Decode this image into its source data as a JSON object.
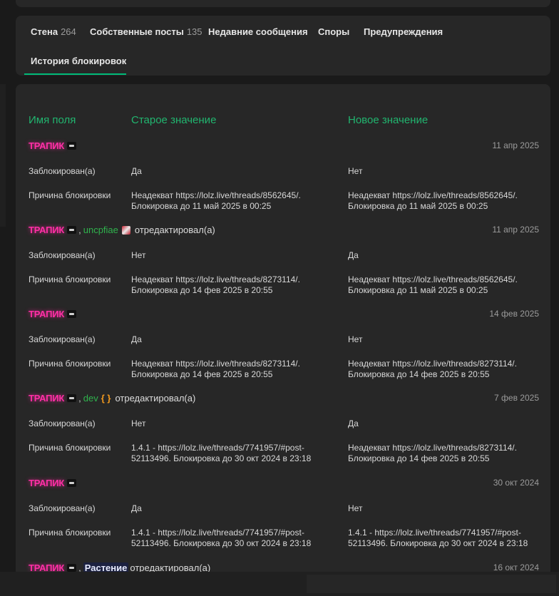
{
  "tabs": [
    {
      "label": "Стена",
      "count": "264"
    },
    {
      "label": "Собственные посты",
      "count": "135"
    },
    {
      "label": "Недавние сообщения",
      "count": ""
    },
    {
      "label": "Споры",
      "count": ""
    },
    {
      "label": "Предупреждения",
      "count": ""
    },
    {
      "label": "История блокировок",
      "count": ""
    }
  ],
  "active_tab": "История блокировок",
  "columns": {
    "field": "Имя поля",
    "old": "Старое значение",
    "new": "Новое значение"
  },
  "users": {
    "trapik": "ТРАПИК",
    "uncpfiae": "uncpfiae",
    "dev": "dev",
    "dev_badge": "{ }",
    "rastenie": "Растение"
  },
  "separator": ",",
  "edited_label": "отредактировал(а)",
  "entries": [
    {
      "date": "11 апр 2025",
      "rows": [
        {
          "field": "Заблокирован(а)",
          "old": "Да",
          "new": "Нет"
        },
        {
          "field": "Причина блокировки",
          "old": "Неадекват https://lolz.live/threads/8562645/. Блокировка до 11 май 2025 в 00:25",
          "new": "Неадекват https://lolz.live/threads/8562645/. Блокировка до 11 май 2025 в 00:25"
        }
      ]
    },
    {
      "date": "11 апр 2025",
      "rows": [
        {
          "field": "Заблокирован(а)",
          "old": "Нет",
          "new": "Да"
        },
        {
          "field": "Причина блокировки",
          "old": "Неадекват https://lolz.live/threads/8273114/. Блокировка до 14 фев 2025 в 20:55",
          "new": "Неадекват https://lolz.live/threads/8562645/. Блокировка до 11 май 2025 в 00:25"
        }
      ]
    },
    {
      "date": "14 фев 2025",
      "rows": [
        {
          "field": "Заблокирован(а)",
          "old": "Да",
          "new": "Нет"
        },
        {
          "field": "Причина блокировки",
          "old": "Неадекват https://lolz.live/threads/8273114/. Блокировка до 14 фев 2025 в 20:55",
          "new": "Неадекват https://lolz.live/threads/8273114/. Блокировка до 14 фев 2025 в 20:55"
        }
      ]
    },
    {
      "date": "7 фев 2025",
      "rows": [
        {
          "field": "Заблокирован(а)",
          "old": "Нет",
          "new": "Да"
        },
        {
          "field": "Причина блокировки",
          "old": "1.4.1 - https://lolz.live/threads/7741957/#post-52113496. Блокировка до 30 окт 2024 в 23:18",
          "new": "Неадекват https://lolz.live/threads/8273114/. Блокировка до 14 фев 2025 в 20:55"
        }
      ]
    },
    {
      "date": "30 окт 2024",
      "rows": [
        {
          "field": "Заблокирован(а)",
          "old": "Да",
          "new": "Нет"
        },
        {
          "field": "Причина блокировки",
          "old": "1.4.1 - https://lolz.live/threads/7741957/#post-52113496. Блокировка до 30 окт 2024 в 23:18",
          "new": "1.4.1 - https://lolz.live/threads/7741957/#post-52113496. Блокировка до 30 окт 2024 в 23:18"
        }
      ]
    },
    {
      "date": "16 окт 2024",
      "rows": []
    }
  ]
}
